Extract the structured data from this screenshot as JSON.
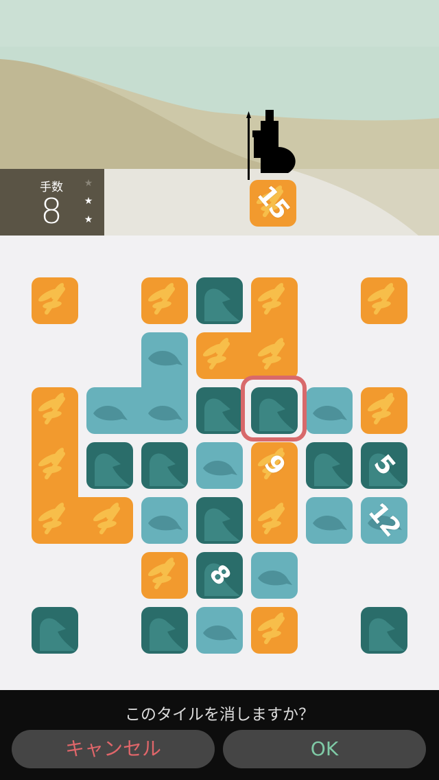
{
  "hud": {
    "moves_label": "手数",
    "moves_value": "8",
    "stars": [
      {
        "filled": false
      },
      {
        "filled": true
      },
      {
        "filled": true
      }
    ],
    "goal_tile": {
      "kind": "dragonfly",
      "number": "15"
    }
  },
  "colors": {
    "orange": "#f29a2e",
    "teal_dark": "#2a6d6a",
    "teal_light": "#67b1bb",
    "selection": "#d8696b",
    "sky": "#c6ddd0",
    "board_bg": "#f2f1f3"
  },
  "board": {
    "tiles": [
      {
        "kind": "dragonfly",
        "cells": [
          [
            0,
            0
          ]
        ]
      },
      {
        "kind": "dragonfly",
        "cells": [
          [
            0,
            2
          ]
        ]
      },
      {
        "kind": "bird",
        "cells": [
          [
            0,
            3
          ]
        ]
      },
      {
        "kind": "dragonfly",
        "cells": [
          [
            0,
            4
          ],
          [
            1,
            4
          ],
          [
            1,
            3
          ]
        ]
      },
      {
        "kind": "dragonfly",
        "cells": [
          [
            0,
            6
          ]
        ]
      },
      {
        "kind": "whale",
        "cells": [
          [
            1,
            2
          ],
          [
            2,
            2
          ],
          [
            2,
            1
          ]
        ]
      },
      {
        "kind": "dragonfly",
        "cells": [
          [
            2,
            0
          ],
          [
            3,
            0
          ],
          [
            4,
            0
          ],
          [
            4,
            1
          ]
        ]
      },
      {
        "kind": "bird",
        "cells": [
          [
            2,
            3
          ]
        ]
      },
      {
        "kind": "bird",
        "cells": [
          [
            2,
            4
          ]
        ],
        "selected": true
      },
      {
        "kind": "whale",
        "cells": [
          [
            2,
            5
          ]
        ]
      },
      {
        "kind": "dragonfly",
        "cells": [
          [
            2,
            6
          ]
        ]
      },
      {
        "kind": "bird",
        "cells": [
          [
            3,
            1
          ]
        ]
      },
      {
        "kind": "bird",
        "cells": [
          [
            3,
            2
          ]
        ]
      },
      {
        "kind": "whale",
        "cells": [
          [
            3,
            3
          ]
        ]
      },
      {
        "kind": "dragonfly",
        "cells": [
          [
            3,
            4
          ],
          [
            4,
            4
          ]
        ],
        "number": "9"
      },
      {
        "kind": "bird",
        "cells": [
          [
            3,
            5
          ]
        ]
      },
      {
        "kind": "bird",
        "cells": [
          [
            3,
            6
          ]
        ],
        "number": "5"
      },
      {
        "kind": "whale",
        "cells": [
          [
            4,
            2
          ]
        ]
      },
      {
        "kind": "bird",
        "cells": [
          [
            4,
            3
          ]
        ]
      },
      {
        "kind": "whale",
        "cells": [
          [
            4,
            5
          ]
        ]
      },
      {
        "kind": "whale",
        "cells": [
          [
            4,
            6
          ]
        ],
        "number": "12"
      },
      {
        "kind": "dragonfly",
        "cells": [
          [
            5,
            2
          ]
        ]
      },
      {
        "kind": "bird",
        "cells": [
          [
            5,
            3
          ]
        ],
        "number": "8"
      },
      {
        "kind": "whale",
        "cells": [
          [
            5,
            4
          ]
        ]
      },
      {
        "kind": "bird",
        "cells": [
          [
            6,
            0
          ]
        ]
      },
      {
        "kind": "bird",
        "cells": [
          [
            6,
            2
          ]
        ]
      },
      {
        "kind": "whale",
        "cells": [
          [
            6,
            3
          ]
        ]
      },
      {
        "kind": "dragonfly",
        "cells": [
          [
            6,
            4
          ]
        ]
      },
      {
        "kind": "bird",
        "cells": [
          [
            6,
            6
          ]
        ]
      }
    ]
  },
  "dialog": {
    "message": "このタイルを消しますか？",
    "cancel_label": "キャンセル",
    "ok_label": "OK"
  }
}
